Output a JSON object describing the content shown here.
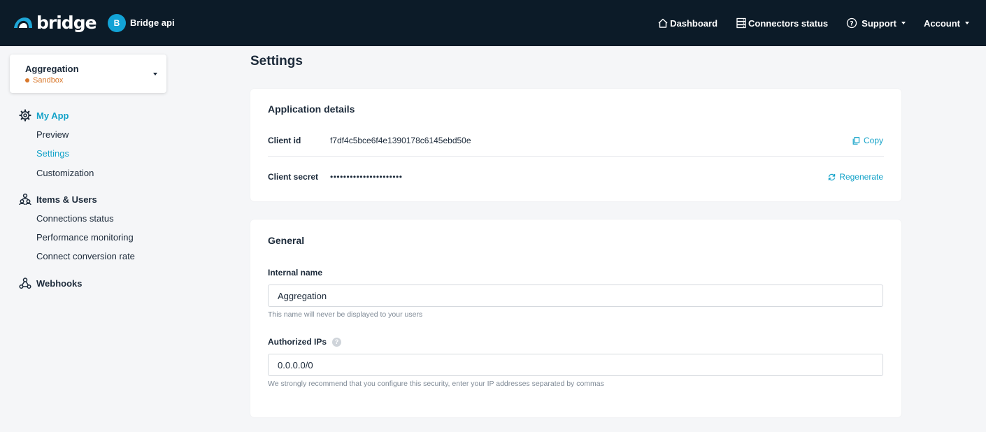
{
  "header": {
    "logo_text": "bridge",
    "app_initial": "B",
    "app_name": "Bridge api",
    "nav": {
      "dashboard": "Dashboard",
      "connectors_status": "Connectors status",
      "support": "Support",
      "account": "Account"
    }
  },
  "environment": {
    "name": "Aggregation",
    "mode": "Sandbox",
    "mode_color": "#d9782b"
  },
  "sidebar": {
    "my_app": {
      "title": "My App",
      "items": [
        "Preview",
        "Settings",
        "Customization"
      ]
    },
    "items_users": {
      "title": "Items & Users",
      "items": [
        "Connections status",
        "Performance monitoring",
        "Connect conversion rate"
      ]
    },
    "webhooks": {
      "title": "Webhooks"
    },
    "active_item": "Settings"
  },
  "main": {
    "title": "Settings",
    "application_details": {
      "title": "Application details",
      "client_id_label": "Client id",
      "client_id_value": "f7df4c5bce6f4e1390178c6145ebd50e",
      "copy_label": "Copy",
      "client_secret_label": "Client secret",
      "client_secret_value": "••••••••••••••••••••••",
      "regenerate_label": "Regenerate"
    },
    "general": {
      "title": "General",
      "internal_name_label": "Internal name",
      "internal_name_value": "Aggregation",
      "internal_name_hint": "This name will never be displayed to your users",
      "authorized_ips_label": "Authorized IPs",
      "authorized_ips_help": "?",
      "authorized_ips_value": "0.0.0.0/0",
      "authorized_ips_hint": "We strongly recommend that you configure this security, enter your IP addresses separated by commas"
    }
  },
  "colors": {
    "topbar": "#0c1b28",
    "accent": "#16a3c9",
    "badge": "#12a3d6"
  }
}
